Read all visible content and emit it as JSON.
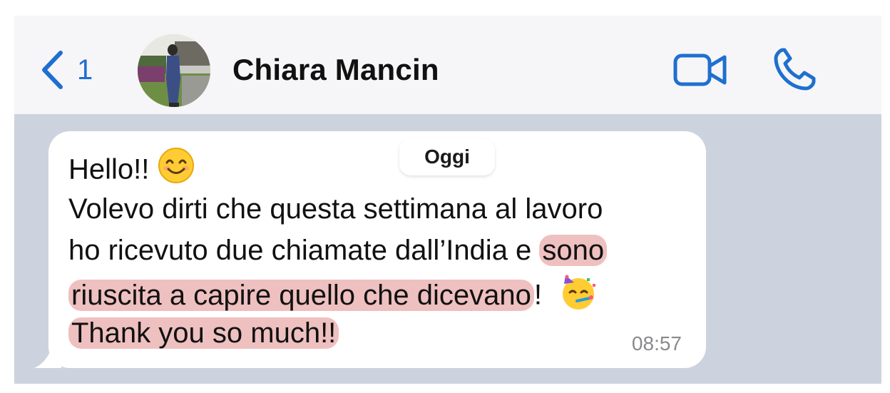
{
  "header": {
    "unread_count": "1",
    "contact_name": "Chiara Mancin"
  },
  "date_separator": "Oggi",
  "message": {
    "line1": "Hello!!",
    "line2": "Volevo dirti che questa settimana al lavoro",
    "line3_plain": "ho ricevuto due chiamate dall’India e ",
    "line3_highlight": "sono",
    "line4_highlight": "riuscita a capire quello che dicevano",
    "line4_tail": "! ",
    "line5_highlight": "Thank you so much!!",
    "time": "08:57"
  },
  "colors": {
    "accent": "#1f6fcf",
    "chat_background": "#cdd3de",
    "highlight": "#e28c8c"
  },
  "icons": [
    "back-chevron-icon",
    "video-call-icon",
    "phone-icon",
    "smiling-face-icon",
    "partying-face-icon"
  ]
}
